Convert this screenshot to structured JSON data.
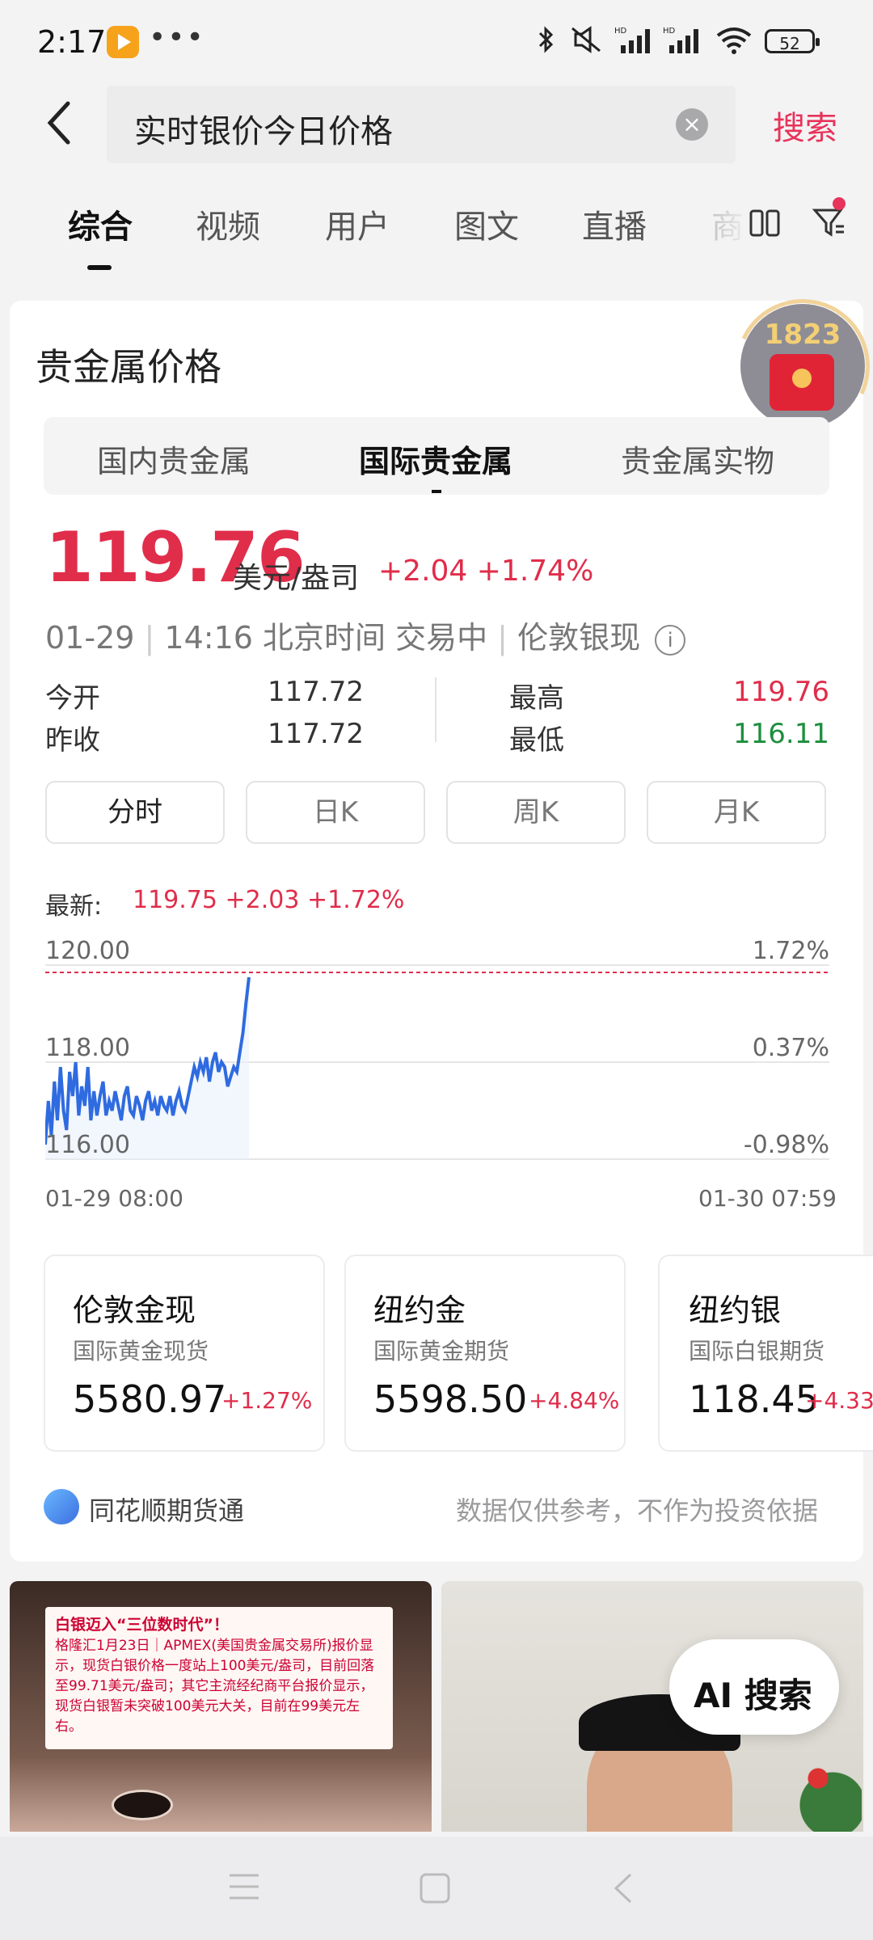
{
  "status_bar": {
    "time": "2:17",
    "dots": "•••",
    "battery": "52"
  },
  "search": {
    "query": "实时银价今日价格",
    "button": "搜索"
  },
  "tabs": [
    {
      "label": "综合"
    },
    {
      "label": "视频"
    },
    {
      "label": "用户"
    },
    {
      "label": "图文"
    },
    {
      "label": "直播"
    },
    {
      "label": "商"
    }
  ],
  "card": {
    "title": "贵金属价格",
    "float_count": "1823",
    "segments": [
      "国内贵金属",
      "国际贵金属",
      "贵金属实物"
    ],
    "price": "119.76",
    "unit": "美元/盎司",
    "change": "+2.04 +1.74%",
    "meta": {
      "date": "01-29",
      "time": "14:16 北京时间 交易中",
      "instrument": "伦敦银现"
    },
    "stats": {
      "open_label": "今开",
      "open": "117.72",
      "prev_label": "昨收",
      "prev": "117.72",
      "high_label": "最高",
      "high": "119.76",
      "low_label": "最低",
      "low": "116.11"
    },
    "kline_tabs": [
      "分时",
      "日K",
      "周K",
      "月K"
    ],
    "latest_label": "最新:",
    "latest_value": "119.75 +2.03 +1.72%",
    "colors": {
      "up": "#e02d4a",
      "down": "#1e8e3e",
      "line": "#2f6be0"
    }
  },
  "chart_data": {
    "type": "line",
    "y_left_ticks": [
      "120.00",
      "118.00",
      "116.00"
    ],
    "y_right_ticks": [
      "1.72%",
      "0.37%",
      "-0.98%"
    ],
    "x_labels": [
      "01-29 08:00",
      "01-30 07:59"
    ],
    "ylim": [
      116.0,
      120.0
    ],
    "ref_line": 119.75,
    "series": [
      {
        "values": [
          116.3,
          117.2,
          116.5,
          117.6,
          116.8,
          117.9,
          117.0,
          116.6,
          117.8,
          117.3,
          118.0,
          116.9,
          117.5,
          117.1,
          117.9,
          116.8,
          117.4,
          116.9,
          117.3,
          117.6,
          116.9,
          117.2,
          117.0,
          117.4,
          117.1,
          116.8,
          117.3,
          117.5,
          117.0,
          116.9,
          117.3,
          117.1,
          116.8,
          117.2,
          117.4,
          117.0,
          117.2,
          116.9,
          117.3,
          117.1,
          117.0,
          117.3,
          116.9,
          117.2,
          117.4,
          117.1,
          117.0,
          117.3,
          117.6,
          117.9,
          117.7,
          118.0,
          117.8,
          118.1,
          117.6,
          118.0,
          118.2,
          117.8,
          118.0,
          117.9,
          117.5,
          117.7,
          117.9,
          117.8,
          118.2,
          118.6,
          119.2,
          119.75
        ]
      }
    ]
  },
  "minis": [
    {
      "title": "伦敦金现",
      "sub": "国际黄金现货",
      "value": "5580.97",
      "change": "+1.27%"
    },
    {
      "title": "纽约金",
      "sub": "国际黄金期货",
      "value": "5598.50",
      "change": "+4.84%"
    },
    {
      "title": "纽约银",
      "sub": "国际白银期货",
      "value": "118.45",
      "change": "+4.33"
    }
  ],
  "footer": {
    "source": "同花顺期货通",
    "disclaimer": "数据仅供参考，不作为投资依据"
  },
  "feed": {
    "thumb1_title": "白银迈入“三位数时代”！",
    "thumb1_body": "格隆汇1月23日｜APMEX(美国贵金属交易所)报价显示，现货白银价格一度站上100美元/盎司，目前回落至99.71美元/盎司；其它主流经纪商平台报价显示，现货白银暂未突破100美元大关，目前在99美元左右。",
    "ai_button": "AI 搜索"
  }
}
